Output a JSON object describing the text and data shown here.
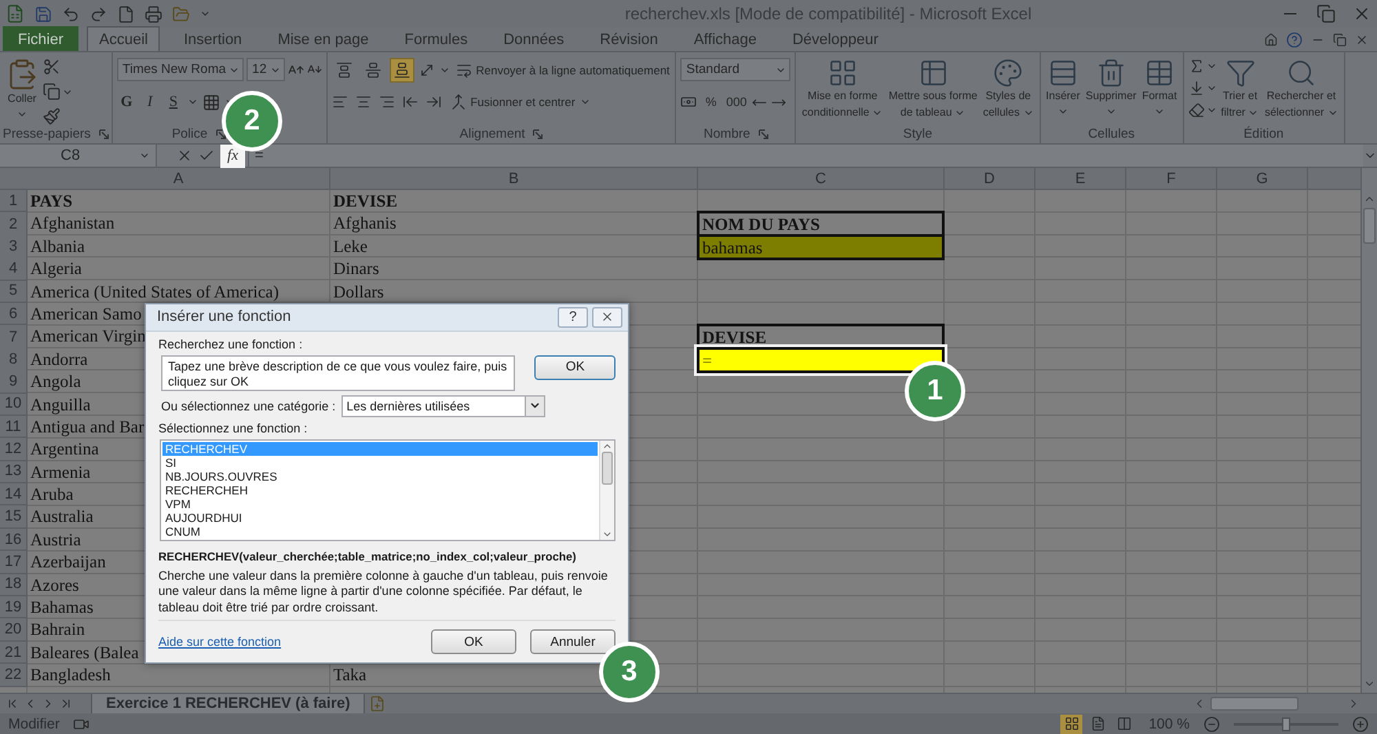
{
  "window": {
    "title": "recherchev.xls  [Mode de compatibilité] - Microsoft Excel"
  },
  "tabs": [
    {
      "label": "Fichier",
      "kind": "file",
      "selected": false
    },
    {
      "label": "Accueil",
      "kind": "tab",
      "selected": true
    },
    {
      "label": "Insertion",
      "kind": "tab",
      "selected": false
    },
    {
      "label": "Mise en page",
      "kind": "tab",
      "selected": false
    },
    {
      "label": "Formules",
      "kind": "tab",
      "selected": false
    },
    {
      "label": "Données",
      "kind": "tab",
      "selected": false
    },
    {
      "label": "Révision",
      "kind": "tab",
      "selected": false
    },
    {
      "label": "Affichage",
      "kind": "tab",
      "selected": false
    },
    {
      "label": "Développeur",
      "kind": "tab",
      "selected": false
    }
  ],
  "ribbon": {
    "groups": [
      {
        "label": "Presse-papiers",
        "kind": "clipboard",
        "paste_label": "Coller"
      },
      {
        "label": "Police",
        "kind": "font",
        "font_name": "Times New Roma",
        "font_size": "12",
        "style_buttons": [
          "G",
          "I",
          "S"
        ]
      },
      {
        "label": "Alignement",
        "kind": "alignment",
        "vertical_align": [
          {
            "selected": false
          },
          {
            "selected": false
          },
          {
            "selected": true
          }
        ],
        "wrap_label": "Renvoyer à la ligne automatiquement",
        "merge_label": "Fusionner et centrer"
      },
      {
        "label": "Nombre",
        "kind": "number",
        "format": "Standard",
        "buttons": [
          "%",
          "000"
        ]
      },
      {
        "label": "Style",
        "kind": "style",
        "buttons": [
          {
            "lines": [
              "Mise en forme",
              "conditionnelle"
            ]
          },
          {
            "lines": [
              "Mettre sous forme",
              "de tableau"
            ]
          },
          {
            "lines": [
              "Styles de",
              "cellules"
            ]
          }
        ]
      },
      {
        "label": "Cellules",
        "kind": "cells",
        "buttons": [
          {
            "lines": [
              "Insérer"
            ]
          },
          {
            "lines": [
              "Supprimer"
            ]
          },
          {
            "lines": [
              "Format"
            ]
          }
        ]
      },
      {
        "label": "Édition",
        "kind": "edition",
        "buttons": [
          {
            "lines": [
              "Trier et",
              "filtrer"
            ]
          },
          {
            "lines": [
              "Rechercher et",
              "sélectionner"
            ]
          }
        ]
      }
    ]
  },
  "formula_bar": {
    "name_box": "C8",
    "fx": "fx",
    "formula": "="
  },
  "sheet": {
    "columns": [
      "A",
      "B",
      "C",
      "D",
      "E",
      "F",
      "G"
    ],
    "rows": [
      {
        "number": "1",
        "a": "PAYS",
        "b": "DEVISE"
      },
      {
        "number": "2",
        "a": "Afghanistan",
        "b": "Afghanis",
        "c": {
          "text": "NOM DU PAYS",
          "kind": "label"
        }
      },
      {
        "number": "3",
        "a": "Albania",
        "b": "Leke",
        "c": {
          "text": "bahamas",
          "kind": "value"
        }
      },
      {
        "number": "4",
        "a": "Algeria",
        "b": "Dinars"
      },
      {
        "number": "5",
        "a": "America (United States of America)",
        "b": "Dollars"
      },
      {
        "number": "6",
        "a": "American Samo"
      },
      {
        "number": "7",
        "a": "American Virgin",
        "c": {
          "text": "DEVISE",
          "kind": "label"
        }
      },
      {
        "number": "8",
        "a": "Andorra",
        "c": {
          "text": "=",
          "kind": "input"
        }
      },
      {
        "number": "9",
        "a": "Angola"
      },
      {
        "number": "10",
        "a": "Anguilla"
      },
      {
        "number": "11",
        "a": "Antigua and Bar"
      },
      {
        "number": "12",
        "a": "Argentina"
      },
      {
        "number": "13",
        "a": "Armenia"
      },
      {
        "number": "14",
        "a": "Aruba"
      },
      {
        "number": "15",
        "a": "Australia"
      },
      {
        "number": "16",
        "a": "Austria"
      },
      {
        "number": "17",
        "a": "Azerbaijan"
      },
      {
        "number": "18",
        "a": "Azores"
      },
      {
        "number": "19",
        "a": "Bahamas"
      },
      {
        "number": "20",
        "a": "Bahrain"
      },
      {
        "number": "21",
        "a": "Baleares (Balea"
      },
      {
        "number": "22",
        "a": "Bangladesh",
        "b": "Taka"
      }
    ]
  },
  "dialog": {
    "title": "Insérer une fonction",
    "help": "?",
    "search_label": "Recherchez une fonction :",
    "search_value": "Tapez une brève description de ce que vous voulez faire, puis cliquez sur OK",
    "search_button": "OK",
    "category_label": "Ou sélectionnez une catégorie :",
    "category": "Les dernières utilisées",
    "list_label": "Sélectionnez une fonction :",
    "functions": [
      {
        "label": "RECHERCHEV",
        "selected": true
      },
      {
        "label": "SI",
        "selected": false
      },
      {
        "label": "NB.JOURS.OUVRES",
        "selected": false
      },
      {
        "label": "RECHERCHEH",
        "selected": false
      },
      {
        "label": "VPM",
        "selected": false
      },
      {
        "label": "AUJOURDHUI",
        "selected": false
      },
      {
        "label": "CNUM",
        "selected": false
      }
    ],
    "signature": "RECHERCHEV(valeur_cherchée;table_matrice;no_index_col;valeur_proche)",
    "description": "Cherche une valeur dans la première colonne à gauche d'un tableau, puis renvoie une valeur dans la même ligne à partir d'une colonne spécifiée. Par défaut, le tableau doit être trié par ordre croissant.",
    "help_link": "Aide sur cette fonction",
    "buttons": [
      {
        "label": "OK"
      },
      {
        "label": "Annuler"
      }
    ]
  },
  "sheet_tabs": [
    {
      "label": "Exercice 1 RECHERCHEV (à faire)",
      "selected": true
    }
  ],
  "status_bar": {
    "mode": "Modifier",
    "views": [
      {
        "selected": true
      },
      {
        "selected": false
      },
      {
        "selected": false
      }
    ],
    "zoom": "100 %",
    "zoom_slider": {
      "level": 0.5
    }
  },
  "callouts": [
    {
      "label": "1"
    },
    {
      "label": "2"
    },
    {
      "label": "3"
    }
  ]
}
